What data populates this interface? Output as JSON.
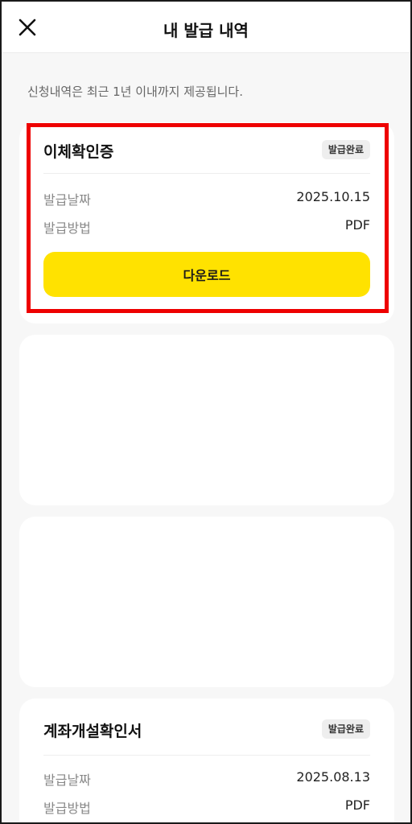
{
  "header": {
    "title": "내 발급 내역"
  },
  "notice": "신청내역은 최근 1년 이내까지 제공됩니다.",
  "issuances": [
    {
      "title": "이체확인증",
      "status": "발급완료",
      "date_label": "발급날짜",
      "date": "2025.10.15",
      "method_label": "발급방법",
      "method": "PDF",
      "download_label": "다운로드"
    },
    {
      "title": "계좌개설확인서",
      "status": "발급완료",
      "date_label": "발급날짜",
      "date": "2025.08.13",
      "method_label": "발급방법",
      "method": "PDF"
    }
  ],
  "colors": {
    "accent": "#ffe200",
    "highlight": "#ee0000",
    "background": "#f7f7f7"
  }
}
